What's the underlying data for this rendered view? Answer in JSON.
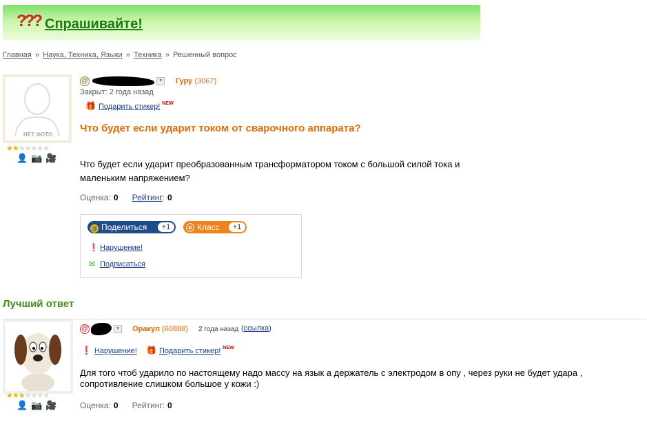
{
  "header": {
    "logo_glyph": "???",
    "title": "Спрашивайте!"
  },
  "breadcrumb": {
    "items": [
      "Главная",
      "Наука, Техника, Языки",
      "Техника"
    ],
    "separator": "»",
    "current": "Решенный вопрос"
  },
  "question": {
    "avatar_label": "НЕТ ФОТО",
    "stars_filled": 2,
    "stars_total": 7,
    "rank": "Гуру",
    "rank_points": "(3067)",
    "closed_text": "Закрыт: 2 года назад",
    "gift_sticker": "Подарить стикер!",
    "new_badge": "NEW",
    "title": "Что будет если ударит током от сварочного аппарата?",
    "body": "Что будет если ударит преобразованным трансформатором током с большой силой тока и маленьким напряжением?",
    "score_label": "Оценка:",
    "score_value": "0",
    "rating_label": "Рейтинг",
    "rating_colon": ":",
    "rating_value": "0"
  },
  "share": {
    "mail_label": "Поделиться",
    "mail_count": "+1",
    "ok_label": "Класс",
    "ok_count": "+1",
    "violation": "Нарушение!",
    "subscribe": "Подписаться"
  },
  "best_answer": {
    "heading": "Лучший ответ",
    "stars_filled": 3,
    "stars_total": 7,
    "rank": "Оракул",
    "rank_points": "(60888)",
    "date": "2 года назад",
    "link_open": "(",
    "link_label": "ссылка",
    "link_close": ")",
    "violation": "Нарушение!",
    "gift_sticker": "Подарить стикер!",
    "new_badge": "NEW",
    "body": "Для того чтоб ударило по настоящему надо массу на язык а держатель с электродом в опу , через руки не будет удара , сопротивление слишком большое у кожи :)",
    "score_label": "Оценка:",
    "score_value": "0",
    "rating_label": "Рейтинг:",
    "rating_value": "0"
  },
  "colors": {
    "accent_orange": "#e26b0a",
    "accent_green": "#3f8f19",
    "link_blue": "#1a3d8f",
    "header_green": "#7fe06a"
  }
}
